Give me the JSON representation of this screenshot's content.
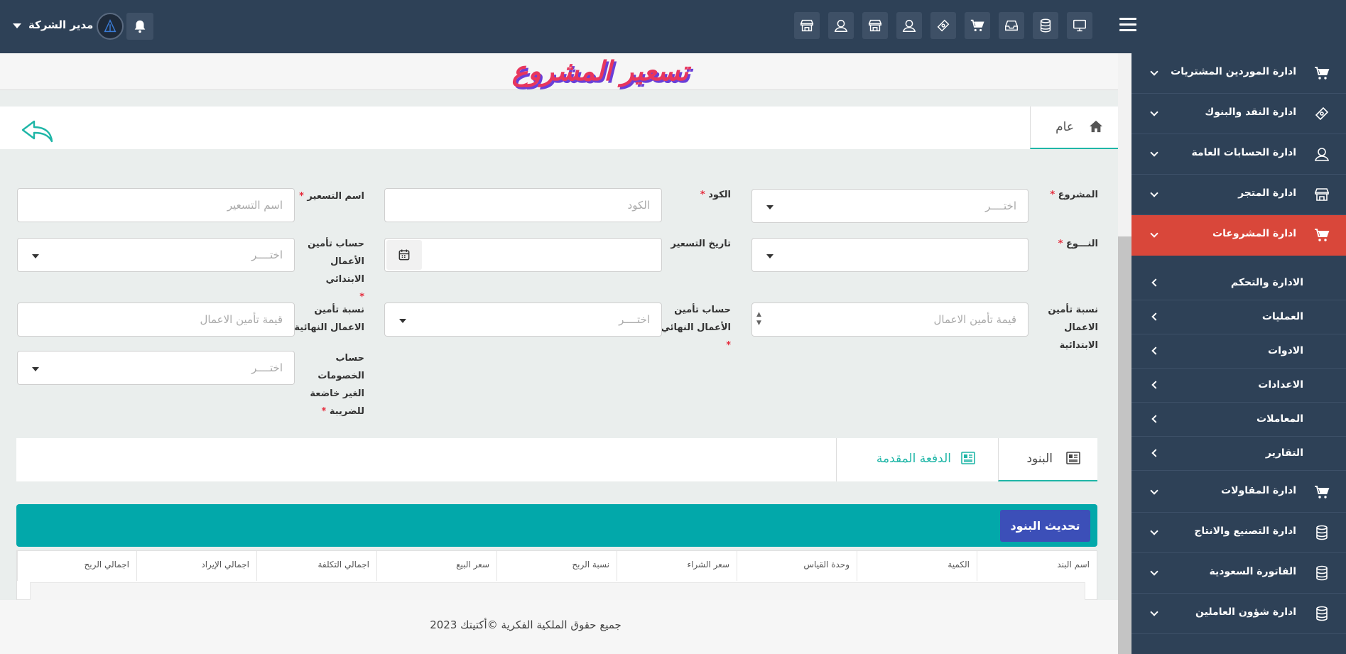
{
  "topbar": {
    "user_name": "مدير الشركة",
    "icons": [
      "store-icon",
      "user-icon",
      "store-icon",
      "user-icon",
      "cash-icon",
      "cart-icon",
      "inbox-icon",
      "database-icon",
      "monitor-icon"
    ]
  },
  "sidebar": {
    "items": [
      {
        "label": "ادارة الموردين المشتريات",
        "icon": "cart-icon"
      },
      {
        "label": "ادارة النقد والبنوك",
        "icon": "cash-icon"
      },
      {
        "label": "ادارة الحسابات العامة",
        "icon": "user-icon"
      },
      {
        "label": "ادارة المتجر",
        "icon": "store-icon"
      },
      {
        "label": "ادارة المشروعات",
        "icon": "cart-icon",
        "active": true
      },
      {
        "label": "ادارة المقاولات",
        "icon": "cart-icon"
      },
      {
        "label": "ادارة التصنيع والانتاج",
        "icon": "database-icon"
      },
      {
        "label": "الفاتورة السعودية",
        "icon": "database-icon"
      },
      {
        "label": "ادارة شؤون العاملين",
        "icon": "database-icon"
      }
    ],
    "sub_items": [
      "الادارة والتحكم",
      "العمليات",
      "الادوات",
      "الاعدادات",
      "المعاملات",
      "التقارير"
    ]
  },
  "page": {
    "title": "تسعير المشروع",
    "general_tab": "عام"
  },
  "form": {
    "project_label": "المشروع",
    "project_placeholder": "اختــــر",
    "code_label": "الكود",
    "code_placeholder": "الكود",
    "pricing_name_label": "اسم التسعير",
    "pricing_name_placeholder": "اسم التسعير",
    "type_label": "النـــوع",
    "pricing_date_label": "تاريخ التسعير",
    "initial_insurance_account_label": "حساب تأمين الأعمال الابتدائي",
    "initial_insurance_account_placeholder": "اختــــر",
    "initial_insurance_ratio_label": "نسبة تأمين الاعمال الابتدائية",
    "initial_insurance_ratio_placeholder": "قيمة تأمين الاعمال",
    "final_insurance_account_label": "حساب تأمين الأعمال النهائي",
    "final_insurance_account_placeholder": "اختــــر",
    "final_insurance_ratio_label": "نسبة تأمين الاعمال النهائية",
    "final_insurance_ratio_placeholder": "قيمة تأمين الاعمال",
    "untaxed_discounts_label": "حساب الخصومات الغير خاضعة للضريبة",
    "untaxed_discounts_placeholder": "اختــــر"
  },
  "lower_tabs": {
    "items_tab": "البنود",
    "advance_tab": "الدفعة المقدمة"
  },
  "toolbar": {
    "refresh_label": "تحديث البنود"
  },
  "table": {
    "headers": [
      "اسم البند",
      "الكمية",
      "وحدة القياس",
      "سعر الشراء",
      "نسبة الربح",
      "سعر البيع",
      "اجمالي التكلفة",
      "اجمالي الإيراد",
      "اجمالي الربح"
    ]
  },
  "footer": {
    "copyright": "جميع حقوق الملكية الفكرية ©أكتيتك 2023"
  },
  "colors": {
    "topbar": "#2e4157",
    "active_item": "#d9473a",
    "teal": "#02a8aa",
    "button": "#3c4fb8",
    "accent": "#1fb6a7"
  }
}
